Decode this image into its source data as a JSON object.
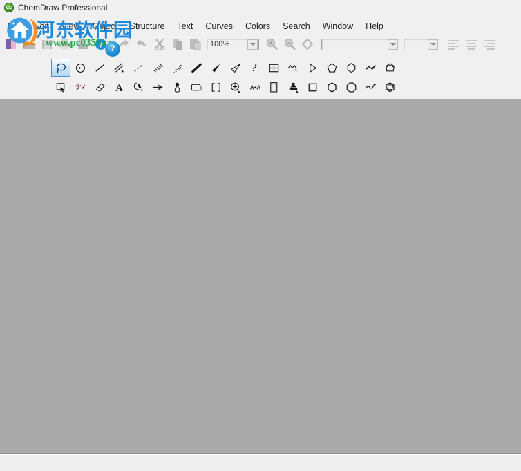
{
  "window": {
    "title": "ChemDraw Professional",
    "app_icon": "chemdraw-cd-icon"
  },
  "menubar": {
    "items": [
      {
        "label": "File"
      },
      {
        "label": "Edit"
      },
      {
        "label": "View"
      },
      {
        "label": "Object"
      },
      {
        "label": "Structure"
      },
      {
        "label": "Text"
      },
      {
        "label": "Curves"
      },
      {
        "label": "Colors"
      },
      {
        "label": "Search"
      },
      {
        "label": "Window"
      },
      {
        "label": "Help"
      }
    ]
  },
  "toolbar": {
    "buttons": [
      {
        "name": "new-document-icon",
        "title": "New"
      },
      {
        "name": "open-document-icon",
        "title": "Open"
      },
      {
        "name": "save-document-icon",
        "title": "Save"
      },
      {
        "name": "print-icon",
        "title": "Print"
      },
      {
        "name": "print-preview-icon",
        "title": "Print Preview"
      },
      {
        "name": "help-icon",
        "title": "Help"
      },
      {
        "name": "undo-icon",
        "title": "Undo"
      },
      {
        "name": "redo-icon",
        "title": "Redo"
      },
      {
        "name": "cut-icon",
        "title": "Cut"
      },
      {
        "name": "copy-icon",
        "title": "Copy"
      },
      {
        "name": "paste-icon",
        "title": "Paste"
      }
    ],
    "zoom_combo": {
      "value": "100%",
      "placeholder": ""
    },
    "zoom_in": {
      "name": "zoom-in-icon"
    },
    "zoom_out": {
      "name": "zoom-out-icon"
    },
    "diamond": {
      "name": "diamond-icon"
    },
    "font_combo": {
      "value": "",
      "placeholder": ""
    },
    "size_combo": {
      "value": "",
      "placeholder": ""
    },
    "align_buttons": [
      {
        "name": "align-left-icon"
      },
      {
        "name": "align-center-icon"
      },
      {
        "name": "align-right-icon"
      }
    ]
  },
  "tool_palette": {
    "selected": "lasso-select-tool",
    "row1": [
      {
        "name": "lasso-select-tool",
        "selected": true
      },
      {
        "name": "marquee-arrow-tool",
        "selected": false
      },
      {
        "name": "solid-bond-tool",
        "selected": false
      },
      {
        "name": "multiple-bond-tool",
        "selected": false
      },
      {
        "name": "dashed-bond-tool",
        "selected": false
      },
      {
        "name": "hashed-bond-tool",
        "selected": false
      },
      {
        "name": "hashed-wedge-bond-tool",
        "selected": false
      },
      {
        "name": "bold-bond-tool",
        "selected": false
      },
      {
        "name": "wedged-bond-tool",
        "selected": false
      },
      {
        "name": "hollow-wedge-bond-tool",
        "selected": false
      },
      {
        "name": "wavy-bond-tool",
        "selected": false
      },
      {
        "name": "table-tool",
        "selected": false
      },
      {
        "name": "chain-tool",
        "selected": false
      },
      {
        "name": "cyclopropane-ring-tool",
        "selected": false
      },
      {
        "name": "cyclopentane-ring-tool",
        "selected": false
      },
      {
        "name": "cyclohexane-ring-tool",
        "selected": false
      },
      {
        "name": "cyclopentadiene-ring-tool",
        "selected": false
      },
      {
        "name": "cyclopentane-chair-tool",
        "selected": false
      }
    ],
    "row2": [
      {
        "name": "marquee-select-tool",
        "selected": false
      },
      {
        "name": "eraser-lasso-tool",
        "selected": false
      },
      {
        "name": "eraser-tool",
        "selected": false
      },
      {
        "name": "text-tool",
        "selected": false
      },
      {
        "name": "pen-tool",
        "selected": false
      },
      {
        "name": "arrow-tool",
        "selected": false
      },
      {
        "name": "orbital-tool",
        "selected": false
      },
      {
        "name": "drawing-elements-tool",
        "selected": false
      },
      {
        "name": "brackets-tool",
        "selected": false
      },
      {
        "name": "query-target-tool",
        "selected": false
      },
      {
        "name": "character-map-tool",
        "selected": false
      },
      {
        "name": "table-grid-tool",
        "selected": false
      },
      {
        "name": "templates-stamp-tool",
        "selected": false
      },
      {
        "name": "square-tool",
        "selected": false
      },
      {
        "name": "benzene-ring-tool",
        "selected": false
      },
      {
        "name": "cyclooctane-ring-tool",
        "selected": false
      },
      {
        "name": "wave-tool",
        "selected": false
      },
      {
        "name": "cyclohexane-3d-tool",
        "selected": false
      }
    ]
  },
  "watermark": {
    "site_name_cn": "河东软件园",
    "site_url": "www.pc0359.cn",
    "badge_glyph": "?"
  },
  "colors": {
    "window_background": "#f0f0f0",
    "canvas_background": "#aaaaaa",
    "selection_blue": "#4a90d9",
    "watermark_blue": "#1e88d8",
    "watermark_green": "#23a64a"
  }
}
